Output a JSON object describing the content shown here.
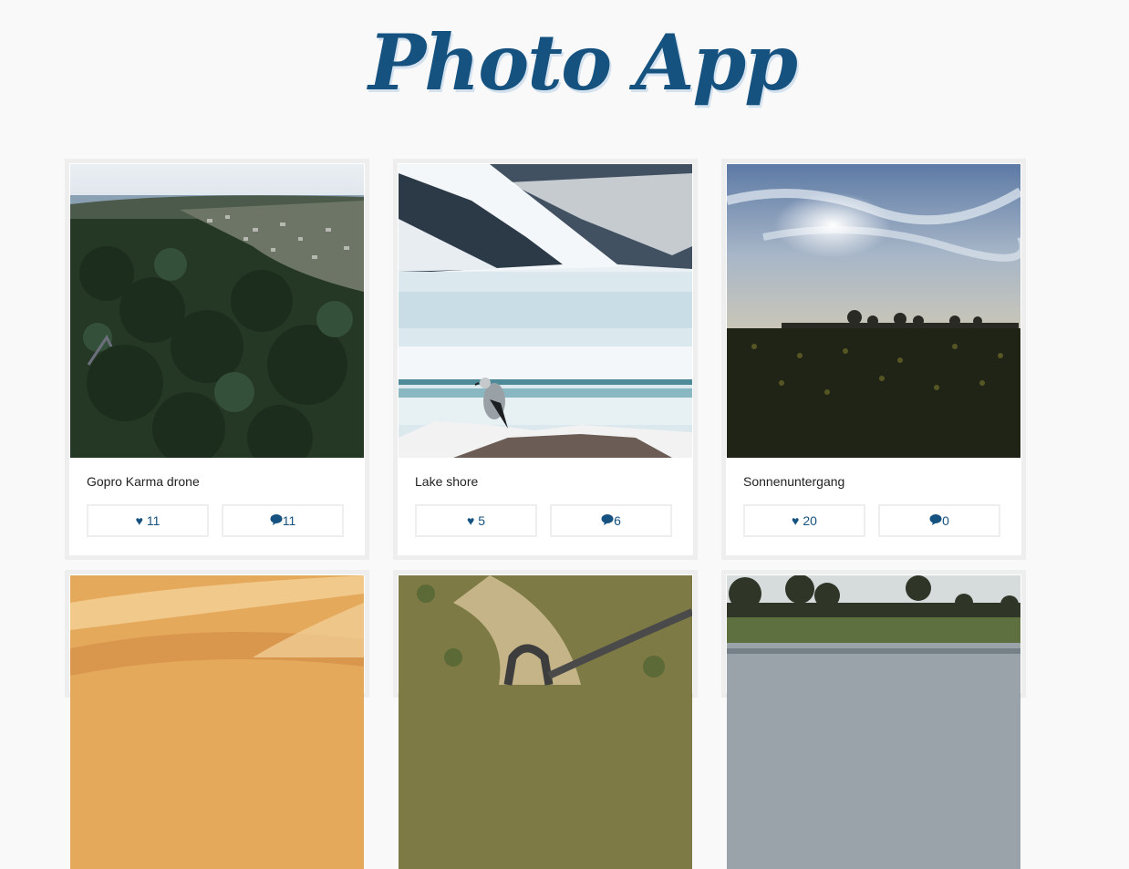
{
  "app": {
    "title": "Photo App"
  },
  "photos": [
    {
      "caption": "Gopro Karma drone",
      "likes": "11",
      "comments": "11"
    },
    {
      "caption": "Lake shore",
      "likes": "5",
      "comments": "6"
    },
    {
      "caption": "Sonnenuntergang",
      "likes": "20",
      "comments": "0"
    },
    {
      "caption": "",
      "likes": "",
      "comments": ""
    },
    {
      "caption": "",
      "likes": "",
      "comments": ""
    },
    {
      "caption": "",
      "likes": "",
      "comments": ""
    }
  ],
  "icons": {
    "like": "heart-icon",
    "comment": "comment-bubble-icon"
  },
  "colors": {
    "accent": "#16527f",
    "background": "#f9f9f9",
    "card_border": "#eeeeee"
  }
}
